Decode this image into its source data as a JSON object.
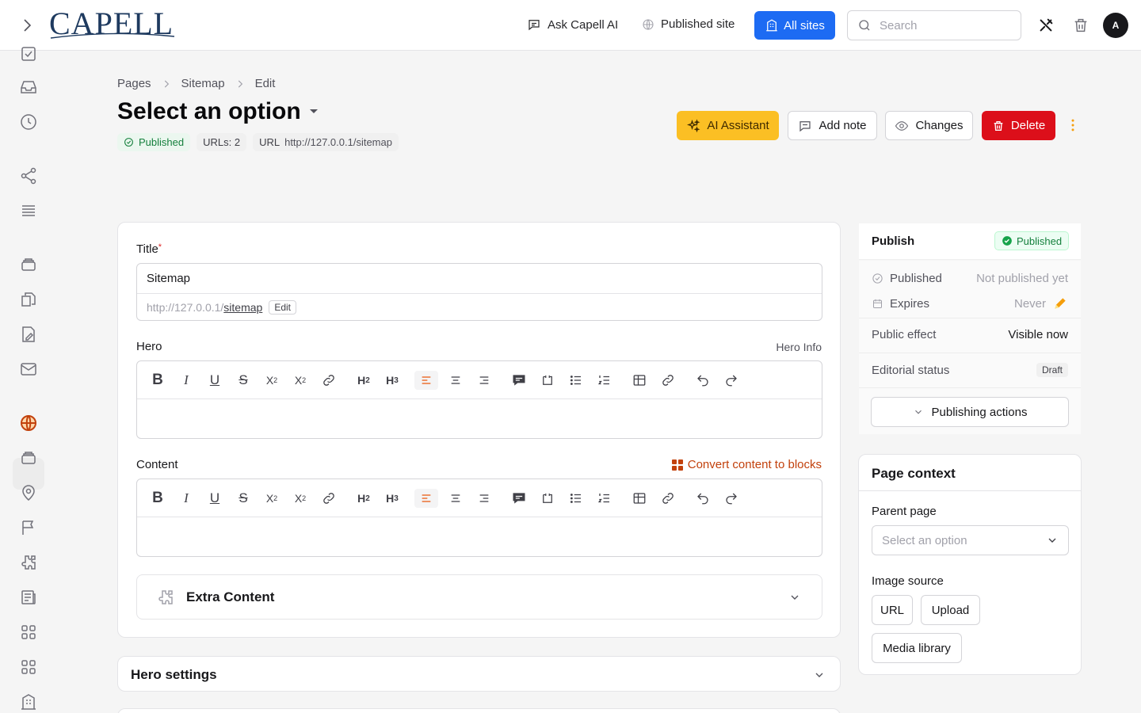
{
  "header": {
    "logo": "CAPELL",
    "ask_ai": "Ask Capell AI",
    "published_site": "Published site",
    "all_sites": "All sites",
    "search_placeholder": "Search",
    "avatar": "A"
  },
  "breadcrumb": [
    "Pages",
    "Sitemap",
    "Edit"
  ],
  "page": {
    "title": "Select an option",
    "status": "Published",
    "urls": "URLs: 2",
    "url_label": "URL",
    "url_value": "http://127.0.0.1/sitemap"
  },
  "actions": {
    "ai": "AI Assistant",
    "note": "Add note",
    "changes": "Changes",
    "delete": "Delete"
  },
  "form": {
    "title_label": "Title",
    "title_required": "*",
    "title_value": "Sitemap",
    "url_base": "http://127.0.0.1/",
    "url_slug": "sitemap",
    "url_edit": "Edit",
    "hero_label": "Hero",
    "hero_info": "Hero Info",
    "content_label": "Content",
    "convert": "Convert content to blocks",
    "extra_content": "Extra Content",
    "hero_settings": "Hero settings"
  },
  "publish": {
    "title": "Publish",
    "badge": "Published",
    "published_k": "Published",
    "published_v": "Not published yet",
    "expires_k": "Expires",
    "expires_v": "Never",
    "effect_k": "Public effect",
    "effect_v": "Visible now",
    "editorial_k": "Editorial status",
    "editorial_v": "Draft",
    "actions": "Publishing actions"
  },
  "context": {
    "title": "Page context",
    "parent_label": "Parent page",
    "parent_placeholder": "Select an option",
    "image_label": "Image source",
    "url_btn": "URL",
    "upload_btn": "Upload",
    "media_btn": "Media library"
  },
  "colors": {
    "primary": "#1d6bf3",
    "ai": "#fbbf24",
    "danger": "#dc0f1a",
    "success": "#15803d",
    "accent": "#ea580c"
  }
}
